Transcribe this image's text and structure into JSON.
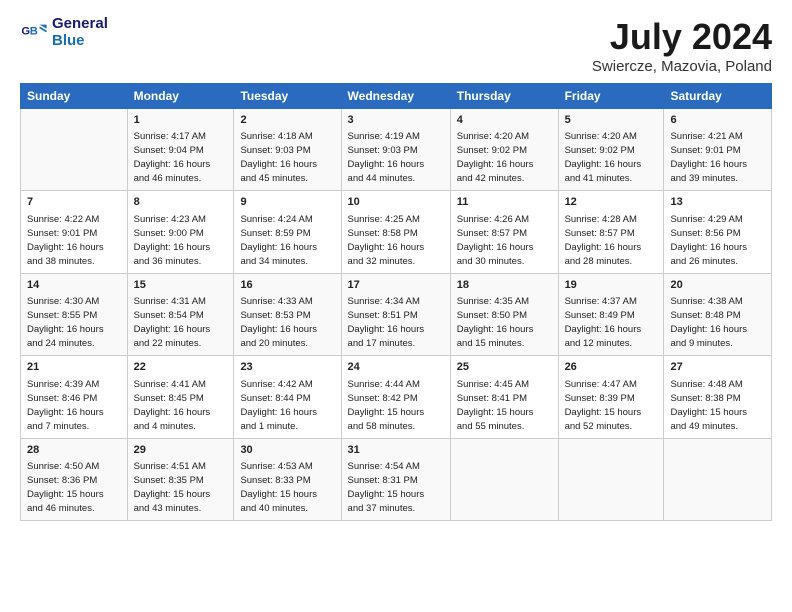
{
  "header": {
    "logo_line1": "General",
    "logo_line2": "Blue",
    "title": "July 2024",
    "location": "Swiercze, Mazovia, Poland"
  },
  "columns": [
    "Sunday",
    "Monday",
    "Tuesday",
    "Wednesday",
    "Thursday",
    "Friday",
    "Saturday"
  ],
  "weeks": [
    {
      "days": [
        {
          "num": "",
          "text": ""
        },
        {
          "num": "1",
          "text": "Sunrise: 4:17 AM\nSunset: 9:04 PM\nDaylight: 16 hours\nand 46 minutes."
        },
        {
          "num": "2",
          "text": "Sunrise: 4:18 AM\nSunset: 9:03 PM\nDaylight: 16 hours\nand 45 minutes."
        },
        {
          "num": "3",
          "text": "Sunrise: 4:19 AM\nSunset: 9:03 PM\nDaylight: 16 hours\nand 44 minutes."
        },
        {
          "num": "4",
          "text": "Sunrise: 4:20 AM\nSunset: 9:02 PM\nDaylight: 16 hours\nand 42 minutes."
        },
        {
          "num": "5",
          "text": "Sunrise: 4:20 AM\nSunset: 9:02 PM\nDaylight: 16 hours\nand 41 minutes."
        },
        {
          "num": "6",
          "text": "Sunrise: 4:21 AM\nSunset: 9:01 PM\nDaylight: 16 hours\nand 39 minutes."
        }
      ]
    },
    {
      "days": [
        {
          "num": "7",
          "text": "Sunrise: 4:22 AM\nSunset: 9:01 PM\nDaylight: 16 hours\nand 38 minutes."
        },
        {
          "num": "8",
          "text": "Sunrise: 4:23 AM\nSunset: 9:00 PM\nDaylight: 16 hours\nand 36 minutes."
        },
        {
          "num": "9",
          "text": "Sunrise: 4:24 AM\nSunset: 8:59 PM\nDaylight: 16 hours\nand 34 minutes."
        },
        {
          "num": "10",
          "text": "Sunrise: 4:25 AM\nSunset: 8:58 PM\nDaylight: 16 hours\nand 32 minutes."
        },
        {
          "num": "11",
          "text": "Sunrise: 4:26 AM\nSunset: 8:57 PM\nDaylight: 16 hours\nand 30 minutes."
        },
        {
          "num": "12",
          "text": "Sunrise: 4:28 AM\nSunset: 8:57 PM\nDaylight: 16 hours\nand 28 minutes."
        },
        {
          "num": "13",
          "text": "Sunrise: 4:29 AM\nSunset: 8:56 PM\nDaylight: 16 hours\nand 26 minutes."
        }
      ]
    },
    {
      "days": [
        {
          "num": "14",
          "text": "Sunrise: 4:30 AM\nSunset: 8:55 PM\nDaylight: 16 hours\nand 24 minutes."
        },
        {
          "num": "15",
          "text": "Sunrise: 4:31 AM\nSunset: 8:54 PM\nDaylight: 16 hours\nand 22 minutes."
        },
        {
          "num": "16",
          "text": "Sunrise: 4:33 AM\nSunset: 8:53 PM\nDaylight: 16 hours\nand 20 minutes."
        },
        {
          "num": "17",
          "text": "Sunrise: 4:34 AM\nSunset: 8:51 PM\nDaylight: 16 hours\nand 17 minutes."
        },
        {
          "num": "18",
          "text": "Sunrise: 4:35 AM\nSunset: 8:50 PM\nDaylight: 16 hours\nand 15 minutes."
        },
        {
          "num": "19",
          "text": "Sunrise: 4:37 AM\nSunset: 8:49 PM\nDaylight: 16 hours\nand 12 minutes."
        },
        {
          "num": "20",
          "text": "Sunrise: 4:38 AM\nSunset: 8:48 PM\nDaylight: 16 hours\nand 9 minutes."
        }
      ]
    },
    {
      "days": [
        {
          "num": "21",
          "text": "Sunrise: 4:39 AM\nSunset: 8:46 PM\nDaylight: 16 hours\nand 7 minutes."
        },
        {
          "num": "22",
          "text": "Sunrise: 4:41 AM\nSunset: 8:45 PM\nDaylight: 16 hours\nand 4 minutes."
        },
        {
          "num": "23",
          "text": "Sunrise: 4:42 AM\nSunset: 8:44 PM\nDaylight: 16 hours\nand 1 minute."
        },
        {
          "num": "24",
          "text": "Sunrise: 4:44 AM\nSunset: 8:42 PM\nDaylight: 15 hours\nand 58 minutes."
        },
        {
          "num": "25",
          "text": "Sunrise: 4:45 AM\nSunset: 8:41 PM\nDaylight: 15 hours\nand 55 minutes."
        },
        {
          "num": "26",
          "text": "Sunrise: 4:47 AM\nSunset: 8:39 PM\nDaylight: 15 hours\nand 52 minutes."
        },
        {
          "num": "27",
          "text": "Sunrise: 4:48 AM\nSunset: 8:38 PM\nDaylight: 15 hours\nand 49 minutes."
        }
      ]
    },
    {
      "days": [
        {
          "num": "28",
          "text": "Sunrise: 4:50 AM\nSunset: 8:36 PM\nDaylight: 15 hours\nand 46 minutes."
        },
        {
          "num": "29",
          "text": "Sunrise: 4:51 AM\nSunset: 8:35 PM\nDaylight: 15 hours\nand 43 minutes."
        },
        {
          "num": "30",
          "text": "Sunrise: 4:53 AM\nSunset: 8:33 PM\nDaylight: 15 hours\nand 40 minutes."
        },
        {
          "num": "31",
          "text": "Sunrise: 4:54 AM\nSunset: 8:31 PM\nDaylight: 15 hours\nand 37 minutes."
        },
        {
          "num": "",
          "text": ""
        },
        {
          "num": "",
          "text": ""
        },
        {
          "num": "",
          "text": ""
        }
      ]
    }
  ]
}
